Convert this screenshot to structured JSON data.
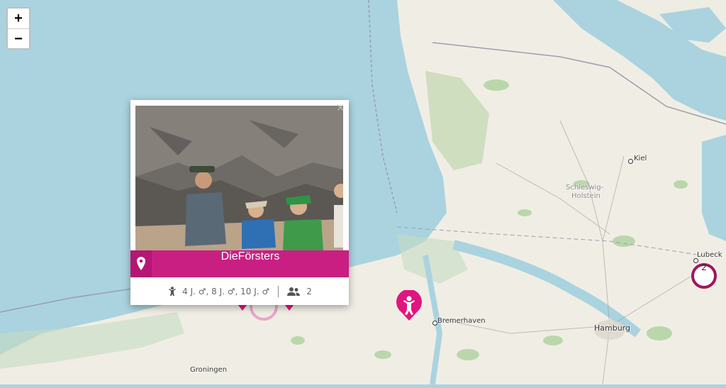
{
  "zoom": {
    "in_label": "+",
    "out_label": "−"
  },
  "map": {
    "labels": {
      "kiel": "Kiel",
      "schleswig_holstein_1": "Schleswig-",
      "schleswig_holstein_2": "Holstein",
      "lubeck": "Lubeck",
      "bremerhaven": "Bremerhaven",
      "hamburg": "Hamburg",
      "groningen": "Groningen"
    }
  },
  "cluster": {
    "count": "2",
    "color": "#a0145e"
  },
  "popup": {
    "close_label": "×",
    "name": "DieFörsters",
    "children_ages": "4 J. ♂, 8 J. ♂, 10 J. ♂",
    "person_count": "2",
    "accent": "#c91f83"
  },
  "colors": {
    "water": "#aad3df",
    "land": "#f0eee4",
    "marker": "#e0157f"
  },
  "icons": [
    "map-pin-icon",
    "child-icon",
    "people-icon",
    "close-icon",
    "family-marker-icon"
  ]
}
